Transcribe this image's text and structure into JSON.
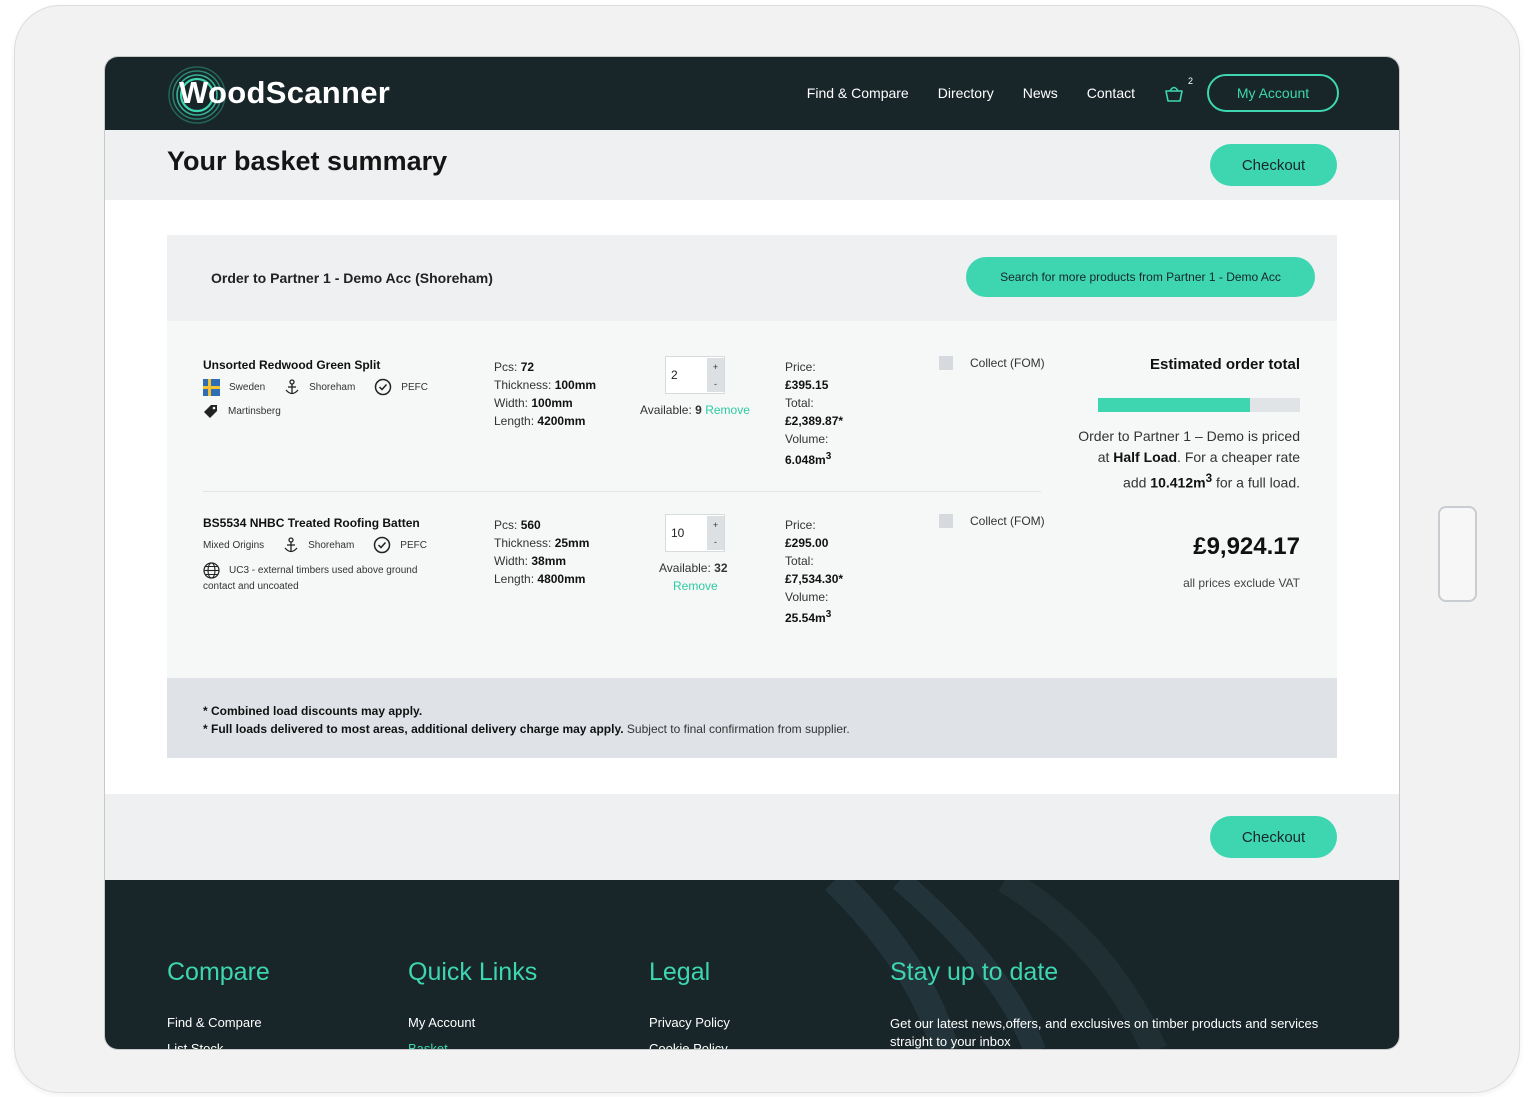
{
  "brand": {
    "name_part1": "Wood",
    "name_part2": "Scanner",
    "accent": "#3dd6b0",
    "dark": "#182529"
  },
  "nav": {
    "links": [
      "Find & Compare",
      "Directory",
      "News",
      "Contact"
    ],
    "basket_count": "2",
    "account_label": "My Account"
  },
  "page": {
    "title": "Your basket summary",
    "checkout_label": "Checkout"
  },
  "order": {
    "title": "Order to Partner 1 - Demo Acc (Shoreham)",
    "search_more_label": "Search for more products from Partner 1 - Demo Acc",
    "items": [
      {
        "name": "Unsorted Redwood Green Split",
        "origin": "Sweden",
        "port": "Shoreham",
        "cert": "PEFC",
        "extra": "Martinsberg",
        "pcs_label": "Pcs:",
        "pcs": "72",
        "thickness_label": "Thickness:",
        "thickness": "100mm",
        "width_label": "Width:",
        "width": "100mm",
        "length_label": "Length:",
        "length": "4200mm",
        "qty": "2",
        "available_label": "Available:",
        "available": "9",
        "remove_label": "Remove",
        "price_label": "Price:",
        "price": "£395.15",
        "total_label": "Total:",
        "total": "£2,389.87*",
        "volume_label": "Volume:",
        "volume": "6.048m",
        "volume_sup": "3",
        "collect_label": "Collect (FOM)"
      },
      {
        "name": "BS5534 NHBC Treated Roofing Batten",
        "origin": "Mixed Origins",
        "port": "Shoreham",
        "cert": "PEFC",
        "extra": "UC3 - external timbers used above ground",
        "extra2": "contact and uncoated",
        "pcs_label": "Pcs:",
        "pcs": "560",
        "thickness_label": "Thickness:",
        "thickness": "25mm",
        "width_label": "Width:",
        "width": "38mm",
        "length_label": "Length:",
        "length": "4800mm",
        "qty": "10",
        "available_label": "Available:",
        "available": "32",
        "remove_label": "Remove",
        "price_label": "Price:",
        "price": "£295.00",
        "total_label": "Total:",
        "total": "£7,534.30*",
        "volume_label": "Volume:",
        "volume": "25.54m",
        "volume_sup": "3",
        "collect_label": "Collect (FOM)"
      }
    ],
    "estimate": {
      "title": "Estimated order total",
      "load_fill_fraction": 0.75,
      "text_a": "Order to Partner 1 – Demo is priced at ",
      "load_type": "Half Load",
      "text_b": ". For a cheaper rate add ",
      "extra_volume": "10.412m",
      "extra_volume_sup": "3",
      "text_c": " for a full load.",
      "total": "£9,924.17",
      "vat_note": "all prices exclude VAT"
    },
    "notes": {
      "note1": "* Combined load discounts may apply.",
      "note2_bold": "* Full loads delivered to most areas, additional delivery charge may apply.",
      "note2_rest": " Subject to final confirmation from supplier."
    }
  },
  "footer": {
    "compare": {
      "heading": "Compare",
      "links": [
        "Find & Compare",
        "List Stock"
      ]
    },
    "quick": {
      "heading": "Quick Links",
      "links": [
        "My Account",
        "Basket"
      ]
    },
    "legal": {
      "heading": "Legal",
      "links": [
        "Privacy Policy",
        "Cookie Policy"
      ]
    },
    "news": {
      "heading": "Stay up to date",
      "text": "Get our latest news,offers, and exclusives on timber products and services straight to your inbox"
    }
  }
}
